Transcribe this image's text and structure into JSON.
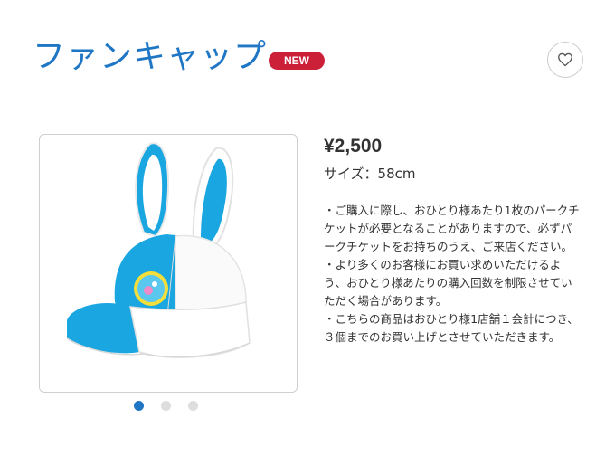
{
  "product": {
    "title": "ファンキャップ",
    "badge": "NEW",
    "price": "¥2,500",
    "size": "サイズ：58cm",
    "notes": [
      "・ご購入に際し、おひとり様あたり1枚のパークチケットが必要となることがありますので、必ずパークチケットをお持ちのうえ、ご来店ください。",
      "・より多くのお客様にお買い求めいただけるよう、おひとり様あたりの購入回数を制限させていただく場合があります。",
      "・こちらの商品はおひとり様1店舗１会計につき、３個までのお買い上げとさせていただきます。"
    ]
  },
  "favorite": {
    "icon": "heart-icon"
  },
  "gallery": {
    "count": 3,
    "active_index": 0
  },
  "colors": {
    "brand_blue": "#1e76c4",
    "badge_red": "#cc1f38",
    "cap_blue": "#1aa6e0"
  }
}
